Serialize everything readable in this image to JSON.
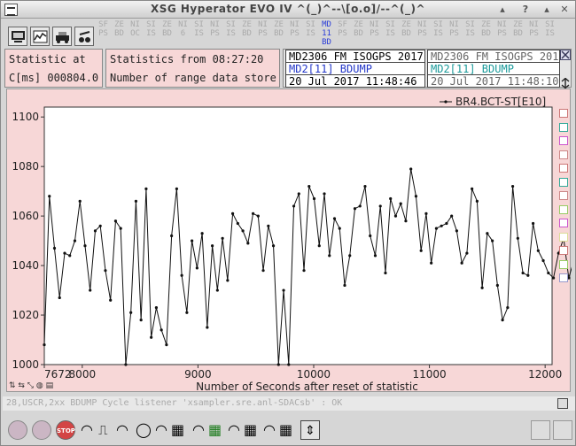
{
  "window": {
    "title": "XSG Hyperator EVO IV  ^(_)^--\\[o.o]/--^(_)^"
  },
  "status_cells": [
    {
      "top": "SF",
      "mid": "PS"
    },
    {
      "top": "ZE",
      "mid": "BD"
    },
    {
      "top": "NI",
      "mid": "OC"
    },
    {
      "top": "SI",
      "mid": "IS"
    },
    {
      "top": "ZE",
      "mid": "BD"
    },
    {
      "top": "NI",
      "mid": "6"
    },
    {
      "top": "SI",
      "mid": "IS"
    },
    {
      "top": "NI",
      "mid": "PS"
    },
    {
      "top": "SI",
      "mid": "IS"
    },
    {
      "top": "ZE",
      "mid": "BD"
    },
    {
      "top": "NI",
      "mid": "PS"
    },
    {
      "top": "ZE",
      "mid": "BD"
    },
    {
      "top": "NI",
      "mid": "PS"
    },
    {
      "top": "SI",
      "mid": "IS"
    },
    {
      "top": "MD",
      "mid": "11",
      "bot": "BD",
      "on": true
    },
    {
      "top": "SF",
      "mid": "PS"
    },
    {
      "top": "ZE",
      "mid": "BD"
    },
    {
      "top": "NI",
      "mid": "PS"
    },
    {
      "top": "SI",
      "mid": "IS"
    },
    {
      "top": "ZE",
      "mid": "BD"
    },
    {
      "top": "NI",
      "mid": "PS"
    },
    {
      "top": "SI",
      "mid": "IS"
    },
    {
      "top": "NI",
      "mid": "PS"
    },
    {
      "top": "SI",
      "mid": "IS"
    },
    {
      "top": "ZE",
      "mid": "BD"
    },
    {
      "top": "NI",
      "mid": "PS"
    },
    {
      "top": "ZE",
      "mid": "BD"
    },
    {
      "top": "NI",
      "mid": "PS"
    },
    {
      "top": "SI",
      "mid": "IS"
    }
  ],
  "info": {
    "statistic_at": "Statistic at",
    "cms": "C[ms] 000804.0",
    "stats_from": "Statistics from 08:27:20",
    "num_range": "Number of range data stored",
    "ds1_name": "MD2306_FM_ISOGPS_2017",
    "ds1_item": "MD2[11] BDUMP",
    "ds1_date": "20 Jul 2017 11:48:46",
    "ds2_name": "MD2306_FM_ISOGPS_2017",
    "ds2_item": "MD2[11] BDUMP",
    "ds2_date": "20 Jul 2017 11:48:10"
  },
  "status_text": "28,USCR,2xx BDUMP Cycle listener 'xsampler.sre.anl-SDACsb' : OK",
  "chart_data": {
    "type": "line",
    "legend": "BR4.BCT-ST[E10]",
    "xlabel": "Number of Seconds after reset of statistic",
    "xlim": [
      7672,
      12060
    ],
    "ylim": [
      1000,
      1104
    ],
    "x_ticks": [
      7672,
      8000,
      9000,
      10000,
      11000,
      12000
    ],
    "y_ticks": [
      1000,
      1020,
      1040,
      1060,
      1080,
      1100
    ],
    "x_start": 7672,
    "x_step": 44,
    "values": [
      1008,
      1068,
      1047,
      1027,
      1045,
      1044,
      1050,
      1066,
      1048,
      1030,
      1054,
      1056,
      1038,
      1026,
      1058,
      1055,
      1000,
      1021,
      1066,
      1018,
      1071,
      1011,
      1023,
      1014,
      1008,
      1052,
      1071,
      1036,
      1021,
      1050,
      1039,
      1053,
      1015,
      1048,
      1030,
      1051,
      1034,
      1061,
      1057,
      1054,
      1049,
      1061,
      1060,
      1038,
      1056,
      1048,
      1000,
      1030,
      1000,
      1064,
      1069,
      1038,
      1072,
      1067,
      1048,
      1069,
      1044,
      1059,
      1055,
      1032,
      1044,
      1063,
      1064,
      1072,
      1052,
      1044,
      1064,
      1037,
      1067,
      1060,
      1065,
      1058,
      1079,
      1068,
      1046,
      1061,
      1041,
      1055,
      1056,
      1057,
      1060,
      1054,
      1041,
      1045,
      1071,
      1066,
      1031,
      1053,
      1050,
      1032,
      1018,
      1023,
      1072,
      1051,
      1037,
      1036,
      1057,
      1046,
      1042,
      1037,
      1035,
      1045,
      1051,
      1035,
      1042,
      1062,
      1051,
      1034,
      1026,
      1062,
      1053,
      1058,
      1073,
      1037,
      1030,
      1071,
      1076,
      1076,
      1044,
      1025,
      1064,
      1009,
      1058,
      1023,
      1026,
      1062,
      1016,
      1023,
      1040,
      1028,
      1025,
      1068,
      1051,
      1036,
      1054,
      1048,
      1019,
      1021,
      1062,
      1028,
      1020,
      1028,
      1033,
      1069,
      1066,
      1045,
      1066,
      1052,
      1056,
      1048,
      1056,
      1046,
      1068,
      1021,
      1043,
      1038,
      1058,
      1046,
      1019,
      1046,
      1062,
      1045
    ]
  }
}
